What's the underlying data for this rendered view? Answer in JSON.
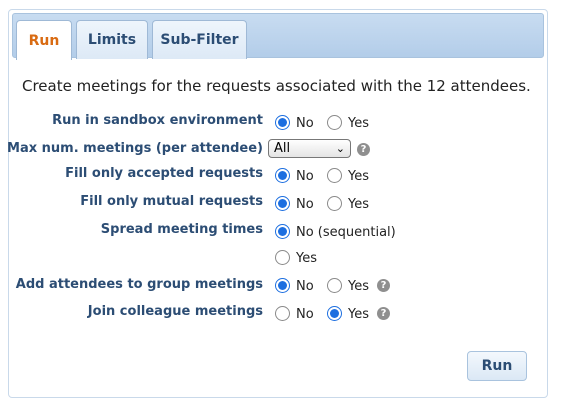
{
  "tabs": [
    "Run",
    "Limits",
    "Sub-Filter"
  ],
  "intro": "Create meetings for the requests associated with the 12 attendees.",
  "fields": {
    "sandbox": {
      "label": "Run in sandbox environment",
      "options": [
        "No",
        "Yes"
      ],
      "selected": "No"
    },
    "max_meetings": {
      "label": "Max num. meetings (per attendee)",
      "value": "All"
    },
    "accepted": {
      "label": "Fill only accepted requests",
      "options": [
        "No",
        "Yes"
      ],
      "selected": "No"
    },
    "mutual": {
      "label": "Fill only mutual requests",
      "options": [
        "No",
        "Yes"
      ],
      "selected": "No"
    },
    "spread": {
      "label": "Spread meeting times",
      "options": [
        "No (sequential)",
        "Yes"
      ],
      "selected": "No (sequential)"
    },
    "group": {
      "label": "Add attendees to group meetings",
      "options": [
        "No",
        "Yes"
      ],
      "selected": "No"
    },
    "colleague": {
      "label": "Join colleague meetings",
      "options": [
        "No",
        "Yes"
      ],
      "selected": "Yes"
    }
  },
  "run_button": "Run",
  "colors": {
    "accent": "#1d6fe0",
    "label": "#2c4d74",
    "active_tab": "#d96b13"
  }
}
